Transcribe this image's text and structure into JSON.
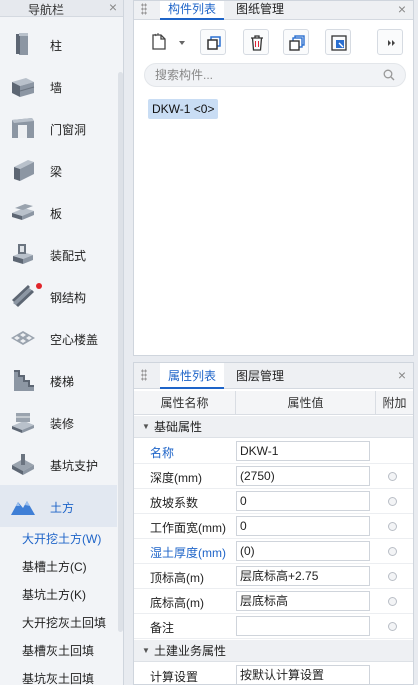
{
  "nav": {
    "title": "导航栏",
    "close": "×",
    "items": [
      {
        "label": "柱",
        "icon": "column-icon"
      },
      {
        "label": "墙",
        "icon": "wall-icon"
      },
      {
        "label": "门窗洞",
        "icon": "door-window-icon"
      },
      {
        "label": "梁",
        "icon": "beam-icon"
      },
      {
        "label": "板",
        "icon": "slab-icon"
      },
      {
        "label": "装配式",
        "icon": "prefab-icon"
      },
      {
        "label": "钢结构",
        "icon": "steel-structure-icon",
        "badge": true
      },
      {
        "label": "空心楼盖",
        "icon": "hollow-floor-icon"
      },
      {
        "label": "楼梯",
        "icon": "stairs-icon"
      },
      {
        "label": "装修",
        "icon": "decoration-icon"
      },
      {
        "label": "基坑支护",
        "icon": "pit-support-icon"
      },
      {
        "label": "土方",
        "icon": "earthwork-icon",
        "active": true
      }
    ],
    "sub_items": [
      {
        "label": "大开挖土方(W)",
        "active": true
      },
      {
        "label": "基槽土方(C)"
      },
      {
        "label": "基坑土方(K)"
      },
      {
        "label": "大开挖灰土回填"
      },
      {
        "label": "基槽灰土回填"
      },
      {
        "label": "基坑灰土回填"
      }
    ]
  },
  "component_panel": {
    "tabs": [
      "构件列表",
      "图纸管理"
    ],
    "close": "×",
    "toolbar": [
      "new-component-icon",
      "dropdown-icon",
      "copy-icon",
      "delete-icon",
      "layer-copy-icon",
      "export-icon",
      "more-icon"
    ],
    "search_placeholder": "搜索构件...",
    "items": [
      "DKW-1 <0>"
    ]
  },
  "property_panel": {
    "tabs": [
      "属性列表",
      "图层管理"
    ],
    "close": "×",
    "columns": [
      "属性名称",
      "属性值",
      "附加"
    ],
    "groups": [
      {
        "label": "基础属性",
        "rows": [
          {
            "name": "名称",
            "value": "DKW-1",
            "blue": true,
            "radio": false
          },
          {
            "name": "深度(mm)",
            "value": "(2750)",
            "radio": true
          },
          {
            "name": "放坡系数",
            "value": "0",
            "radio": true
          },
          {
            "name": "工作面宽(mm)",
            "value": "0",
            "radio": true
          },
          {
            "name": "湿土厚度(mm)",
            "value": "(0)",
            "blue": true,
            "radio": true
          },
          {
            "name": "顶标高(m)",
            "value": "层底标高+2.75",
            "radio": true
          },
          {
            "name": "底标高(m)",
            "value": "层底标高",
            "radio": true
          },
          {
            "name": "备注",
            "value": "",
            "radio": true
          }
        ]
      },
      {
        "label": "土建业务属性",
        "rows": [
          {
            "name": "计算设置",
            "value": "按默认计算设置",
            "radio": false
          }
        ]
      }
    ]
  },
  "colors": {
    "accent": "#1e64c8",
    "selected_bg": "#c9ddf4",
    "badge": "#e0242a"
  }
}
